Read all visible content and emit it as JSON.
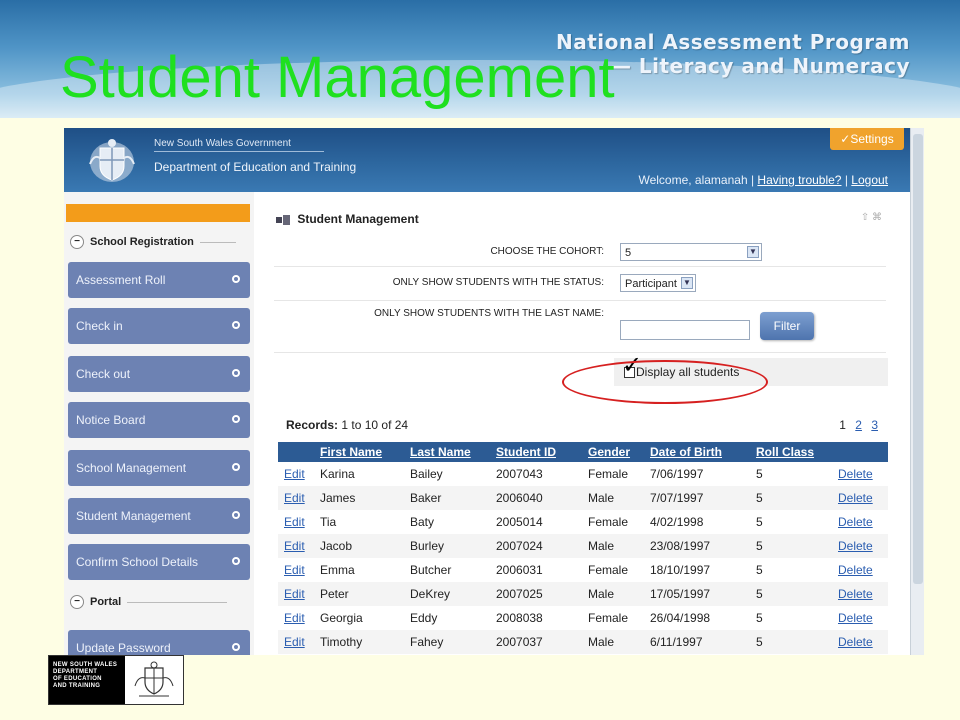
{
  "slide": {
    "program_title_line1": "National Assessment Program",
    "program_title_line2": "— Literacy and Numeracy",
    "title": "Student Management"
  },
  "header": {
    "gov_name": "New South Wales Government",
    "dept_name": "Department of Education and Training",
    "settings_label": "✓Settings",
    "welcome_text": "Welcome, alamanah |",
    "help_link": "Having trouble?",
    "separator": "|",
    "logout_link": "Logout"
  },
  "sidebar": {
    "sections": [
      {
        "label": "School Registration"
      },
      {
        "label": "Portal"
      }
    ],
    "items": [
      {
        "label": "Assessment Roll"
      },
      {
        "label": "Check in"
      },
      {
        "label": "Check out"
      },
      {
        "label": "Notice Board"
      },
      {
        "label": "School Management"
      },
      {
        "label": "Student Management"
      },
      {
        "label": "Confirm School Details"
      },
      {
        "label": "Update Password"
      }
    ]
  },
  "panel": {
    "title": "Student Management",
    "cohort_label": "CHOOSE THE COHORT:",
    "cohort_value": "5",
    "status_label": "ONLY SHOW STUDENTS WITH THE STATUS:",
    "status_value": "Participant",
    "lastname_label": "ONLY SHOW STUDENTS WITH THE LAST NAME:",
    "lastname_value": "",
    "filter_label": "Filter",
    "display_all_label": "Display all students",
    "display_all_checked": true,
    "records_label": "Records:",
    "records_value": "1 to 10 of 24",
    "pages": [
      "1",
      "2",
      "3"
    ]
  },
  "table": {
    "columns": [
      "First Name",
      "Last Name",
      "Student ID",
      "Gender",
      "Date of Birth",
      "Roll Class"
    ],
    "edit_label": "Edit",
    "delete_label": "Delete",
    "rows": [
      [
        "Karina",
        "Bailey",
        "2007043",
        "Female",
        "7/06/1997",
        "5"
      ],
      [
        "James",
        "Baker",
        "2006040",
        "Male",
        "7/07/1997",
        "5"
      ],
      [
        "Tia",
        "Baty",
        "2005014",
        "Female",
        "4/02/1998",
        "5"
      ],
      [
        "Jacob",
        "Burley",
        "2007024",
        "Male",
        "23/08/1997",
        "5"
      ],
      [
        "Emma",
        "Butcher",
        "2006031",
        "Female",
        "18/10/1997",
        "5"
      ],
      [
        "Peter",
        "DeKrey",
        "2007025",
        "Male",
        "17/05/1997",
        "5"
      ],
      [
        "Georgia",
        "Eddy",
        "2008038",
        "Female",
        "26/04/1998",
        "5"
      ],
      [
        "Timothy",
        "Fahey",
        "2007037",
        "Male",
        "6/11/1997",
        "5"
      ]
    ]
  },
  "footer": {
    "logo_lines": [
      "NEW SOUTH WALES",
      "DEPARTMENT",
      "OF EDUCATION",
      "AND TRAINING"
    ]
  },
  "colors": {
    "title_green": "#1fe01f",
    "nav_blue": "#6d82b3",
    "header_blue": "#2c5b94",
    "settings_orange": "#f0a32d",
    "highlight_red": "#d62020"
  }
}
